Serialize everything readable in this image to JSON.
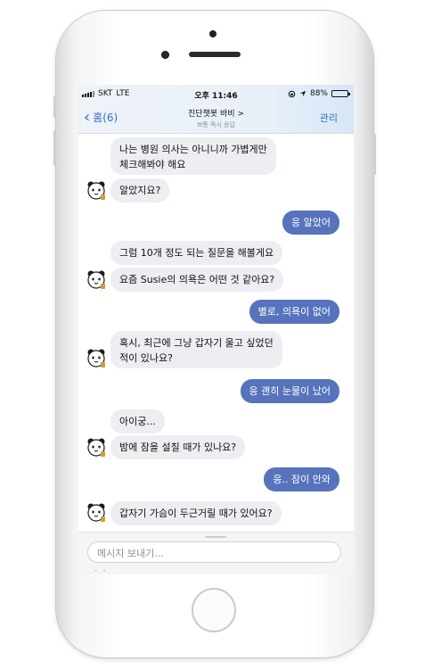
{
  "status_bar": {
    "carrier": "SKT",
    "network": "LTE",
    "time": "오후 11:46",
    "battery": "88%",
    "battery_level": 0.88
  },
  "header": {
    "back_label": "홈(6)",
    "title": "진단챗봇 바비",
    "title_chevron": ">",
    "subtitle": "보통 즉시 응답",
    "manage_label": "관리"
  },
  "messages": [
    {
      "sender": "bot",
      "lines": [
        "나는 병원 의사는 아니니까 가볍게만",
        "체크해봐야 해요"
      ]
    },
    {
      "sender": "bot",
      "lines": [
        "알았지요?"
      ]
    },
    {
      "sender": "user",
      "lines": [
        "응 알았어"
      ]
    },
    {
      "sender": "bot",
      "lines": [
        "그럼 10개 정도 되는 질문을 해볼게요"
      ]
    },
    {
      "sender": "bot",
      "lines": [
        "요즘 Susie의 의욕은 어떤 것 같아요?"
      ]
    },
    {
      "sender": "user",
      "lines": [
        "별로, 의욕이 없어"
      ]
    },
    {
      "sender": "bot",
      "lines": [
        "혹시, 최근에 그냥 갑자기 울고 싶었던",
        "적이 있나요?"
      ]
    },
    {
      "sender": "user",
      "lines": [
        "응 괜히 눈물이 났어"
      ]
    },
    {
      "sender": "bot",
      "lines": [
        "아이궁..."
      ]
    },
    {
      "sender": "bot",
      "lines": [
        "밤에 잠을 설칠 때가 있나요?"
      ]
    },
    {
      "sender": "user",
      "lines": [
        "응.. 잠이 안와"
      ]
    },
    {
      "sender": "bot",
      "lines": [
        "갑자기 가슴이 두근거릴 때가 있어요?"
      ]
    }
  ],
  "composer": {
    "placeholder": "메시지 보내기..."
  },
  "colors": {
    "accent": "#3a6fbf",
    "user_bubble": "#5673bc",
    "bot_bubble": "#eceef1"
  }
}
